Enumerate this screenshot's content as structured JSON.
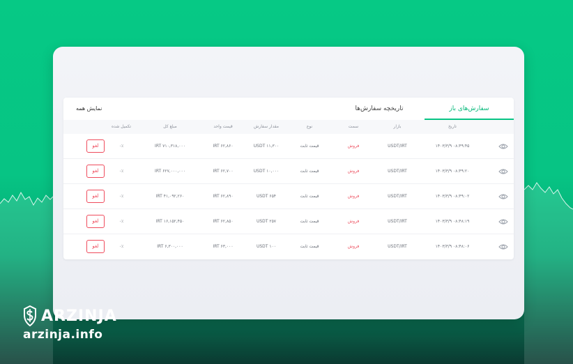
{
  "tabs": {
    "open_orders": "سفارش‌های باز",
    "order_history": "تاریخچه سفارش‌ها",
    "show_all": "نمایش همه"
  },
  "columns": {
    "date": "تاریخ",
    "market": "بازار",
    "side": "سمت",
    "type": "نوع",
    "order_amount": "مقدار سفارش",
    "unit_price": "قیمت واحد",
    "total": "مبلغ کل",
    "filled": "تکمیل شده"
  },
  "rows": [
    {
      "date": "۱۴۰۳/۳/۹ ۰۸:۴۹:۴۵",
      "market": "USDT/IRT",
      "side": "فروش",
      "type": "قیمت ثابت",
      "amount": "USDT ۱۱,۳۰۰",
      "price": "IRT ۶۲,۸۶۰",
      "total": "IRT ۷۱۰,۳۱۸,۰۰۰",
      "filled": "۰٪",
      "cancel": "لغو"
    },
    {
      "date": "۱۴۰۳/۳/۹ ۰۸:۴۹:۲۰",
      "market": "USDT/IRT",
      "side": "فروش",
      "type": "قیمت ثابت",
      "amount": "USDT ۱۰,۰۰۰",
      "price": "IRT ۶۲,۷۰۰",
      "total": "IRT ۶۲۷,۰۰۰,۰۰۰",
      "filled": "۰٪",
      "cancel": "لغو"
    },
    {
      "date": "۱۴۰۳/۳/۹ ۰۸:۴۹:۰۲",
      "market": "USDT/IRT",
      "side": "فروش",
      "type": "قیمت ثابت",
      "amount": "USDT ۶۵۴",
      "price": "IRT ۶۲,۸۹۰",
      "total": "IRT ۴۱,۰۹۲,۲۶۰",
      "filled": "۰٪",
      "cancel": "لغو"
    },
    {
      "date": "۱۴۰۳/۳/۹ ۰۸:۴۸:۱۹",
      "market": "USDT/IRT",
      "side": "فروش",
      "type": "قیمت ثابت",
      "amount": "USDT ۲۵۷",
      "price": "IRT ۶۲,۸۵۰",
      "total": "IRT ۱۶,۱۵۲,۴۵۰",
      "filled": "۰٪",
      "cancel": "لغو"
    },
    {
      "date": "۱۴۰۳/۳/۹ ۰۸:۴۸:۰۶",
      "market": "USDT/IRT",
      "side": "فروش",
      "type": "قیمت ثابت",
      "amount": "USDT ۱۰۰",
      "price": "IRT ۶۳,۰۰۰",
      "total": "IRT ۶,۳۰۰,۰۰۰",
      "filled": "۰٪",
      "cancel": "لغو"
    }
  ],
  "brand": {
    "name": "ARZINJA",
    "url": "arzinja.info"
  },
  "colors": {
    "accent": "#07c484",
    "sell": "#ec4a5a"
  }
}
